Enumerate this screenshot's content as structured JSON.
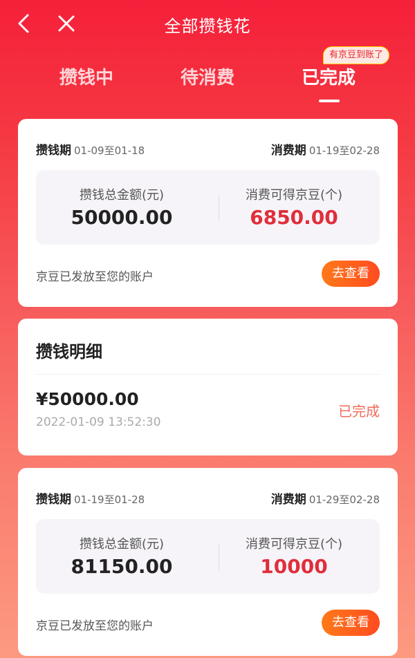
{
  "header": {
    "title": "全部攒钱花",
    "back_icon": "chevron-left-icon",
    "close_icon": "close-icon"
  },
  "tabs": [
    {
      "label": "攒钱中"
    },
    {
      "label": "待消费"
    },
    {
      "label": "已完成",
      "active": true
    }
  ],
  "tab_badge": "有京豆到账了",
  "cards": [
    {
      "save_period_label": "攒钱期",
      "save_period": "01-09至01-18",
      "spend_period_label": "消费期",
      "spend_period": "01-19至02-28",
      "total_label": "攒钱总金额(元)",
      "total_value": "50000.00",
      "beans_label": "消费可得京豆(个)",
      "beans_value": "6850.00",
      "footer": "京豆已发放至您的账户",
      "button": "去查看"
    },
    {
      "save_period_label": "攒钱期",
      "save_period": "01-19至01-28",
      "spend_period_label": "消费期",
      "spend_period": "01-29至02-28",
      "total_label": "攒钱总金额(元)",
      "total_value": "81150.00",
      "beans_label": "消费可得京豆(个)",
      "beans_value": "10000",
      "footer": "京豆已发放至您的账户",
      "button": "去查看"
    }
  ],
  "detail": {
    "title": "攒钱明细",
    "amount": "¥50000.00",
    "time": "2022-01-09 13:52:30",
    "status": "已完成"
  },
  "colors": {
    "accent_red": "#e02e3b",
    "button_orange": "#ff5a1f",
    "status_text": "#ef6b5a"
  }
}
